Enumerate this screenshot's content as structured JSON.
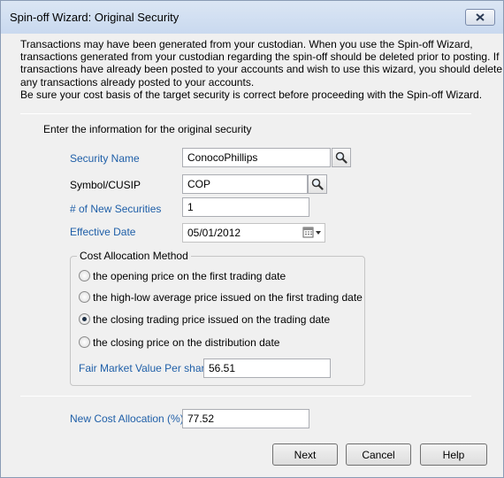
{
  "window": {
    "title": "Spin-off Wizard: Original Security"
  },
  "intro": {
    "lines": [
      "Transactions may have been generated from your custodian. When you use the Spin-off Wizard,",
      "transactions generated from your custodian regarding the spin-off should be deleted prior to posting. If",
      "transactions have already been posted to your accounts and wish to use this wizard, you should delete",
      "any transactions already posted to your accounts.",
      "Be sure your cost basis of the target security is correct before proceeding with the Spin-off Wizard."
    ]
  },
  "form": {
    "heading": "Enter the information for the original security",
    "security_name": {
      "label": "Security Name",
      "value": "ConocoPhillips"
    },
    "symbol": {
      "label": "Symbol/CUSIP",
      "value": "COP"
    },
    "num_new": {
      "label": "# of New Securities",
      "value": "1"
    },
    "effective_date": {
      "label": "Effective Date",
      "value": "05/01/2012"
    }
  },
  "cost_allocation": {
    "title": "Cost Allocation Method",
    "options": [
      "the opening price on the first trading date",
      "the high-low average price issued on the first trading date",
      "the closing trading price issued on the trading date",
      "the closing price on the distribution date"
    ],
    "selected_index": 2,
    "fmv_label": "Fair Market Value Per share",
    "fmv_value": "56.51"
  },
  "new_cost_allocation": {
    "label": "New Cost Allocation (%)",
    "value": "77.52"
  },
  "buttons": {
    "next": "Next",
    "cancel": "Cancel",
    "help": "Help"
  },
  "colors": {
    "label_blue": "#1f5fa8",
    "title_bar": "#c9d9ef"
  }
}
